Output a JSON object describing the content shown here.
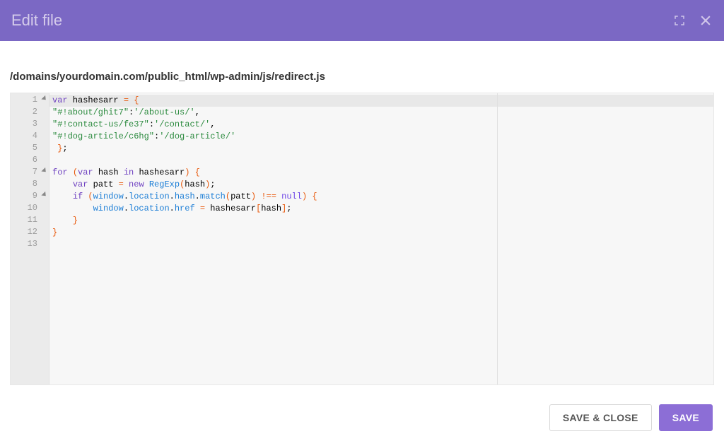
{
  "header": {
    "title": "Edit file"
  },
  "filepath": "/domains/yourdomain.com/public_html/wp-admin/js/redirect.js",
  "editor": {
    "line_count": 13,
    "fold_lines": [
      1,
      7,
      9
    ],
    "active_line": 1,
    "lines": [
      {
        "num": "1",
        "tokens": [
          {
            "t": "var",
            "c": "tok-kw"
          },
          {
            "t": " hashesarr ",
            "c": ""
          },
          {
            "t": "=",
            "c": "tok-op"
          },
          {
            "t": " ",
            "c": ""
          },
          {
            "t": "{",
            "c": "tok-punc"
          }
        ]
      },
      {
        "num": "2",
        "tokens": [
          {
            "t": "\"#!about/ghit7\"",
            "c": "tok-str"
          },
          {
            "t": ":",
            "c": ""
          },
          {
            "t": "'/about-us/'",
            "c": "tok-str"
          },
          {
            "t": ",",
            "c": ""
          }
        ]
      },
      {
        "num": "3",
        "tokens": [
          {
            "t": "\"#!contact-us/fe37\"",
            "c": "tok-str"
          },
          {
            "t": ":",
            "c": ""
          },
          {
            "t": "'/contact/'",
            "c": "tok-str"
          },
          {
            "t": ",",
            "c": ""
          }
        ]
      },
      {
        "num": "4",
        "tokens": [
          {
            "t": "\"#!dog-article/c6hg\"",
            "c": "tok-str"
          },
          {
            "t": ":",
            "c": ""
          },
          {
            "t": "'/dog-article/'",
            "c": "tok-str"
          }
        ]
      },
      {
        "num": "5",
        "tokens": [
          {
            "t": " ",
            "c": ""
          },
          {
            "t": "}",
            "c": "tok-punc"
          },
          {
            "t": ";",
            "c": ""
          }
        ]
      },
      {
        "num": "6",
        "tokens": []
      },
      {
        "num": "7",
        "tokens": [
          {
            "t": "for",
            "c": "tok-kw"
          },
          {
            "t": " ",
            "c": ""
          },
          {
            "t": "(",
            "c": "tok-punc"
          },
          {
            "t": "var",
            "c": "tok-kw"
          },
          {
            "t": " hash ",
            "c": ""
          },
          {
            "t": "in",
            "c": "tok-kw"
          },
          {
            "t": " hashesarr",
            "c": ""
          },
          {
            "t": ")",
            "c": "tok-punc"
          },
          {
            "t": " ",
            "c": ""
          },
          {
            "t": "{",
            "c": "tok-punc"
          }
        ]
      },
      {
        "num": "8",
        "tokens": [
          {
            "t": "    ",
            "c": ""
          },
          {
            "t": "var",
            "c": "tok-kw"
          },
          {
            "t": " patt ",
            "c": ""
          },
          {
            "t": "=",
            "c": "tok-op"
          },
          {
            "t": " ",
            "c": ""
          },
          {
            "t": "new",
            "c": "tok-kw"
          },
          {
            "t": " ",
            "c": ""
          },
          {
            "t": "RegExp",
            "c": "tok-ident"
          },
          {
            "t": "(",
            "c": "tok-punc"
          },
          {
            "t": "hash",
            "c": ""
          },
          {
            "t": ")",
            "c": "tok-punc"
          },
          {
            "t": ";",
            "c": ""
          }
        ]
      },
      {
        "num": "9",
        "tokens": [
          {
            "t": "    ",
            "c": ""
          },
          {
            "t": "if",
            "c": "tok-kw"
          },
          {
            "t": " ",
            "c": ""
          },
          {
            "t": "(",
            "c": "tok-punc"
          },
          {
            "t": "window",
            "c": "tok-ident"
          },
          {
            "t": ".",
            "c": ""
          },
          {
            "t": "location",
            "c": "tok-method"
          },
          {
            "t": ".",
            "c": ""
          },
          {
            "t": "hash",
            "c": "tok-method"
          },
          {
            "t": ".",
            "c": ""
          },
          {
            "t": "match",
            "c": "tok-method"
          },
          {
            "t": "(",
            "c": "tok-punc"
          },
          {
            "t": "patt",
            "c": ""
          },
          {
            "t": ")",
            "c": "tok-punc"
          },
          {
            "t": " ",
            "c": ""
          },
          {
            "t": "!==",
            "c": "tok-op"
          },
          {
            "t": " ",
            "c": ""
          },
          {
            "t": "null",
            "c": "tok-null"
          },
          {
            "t": ")",
            "c": "tok-punc"
          },
          {
            "t": " ",
            "c": ""
          },
          {
            "t": "{",
            "c": "tok-punc"
          }
        ]
      },
      {
        "num": "10",
        "tokens": [
          {
            "t": "        ",
            "c": ""
          },
          {
            "t": "window",
            "c": "tok-ident"
          },
          {
            "t": ".",
            "c": ""
          },
          {
            "t": "location",
            "c": "tok-method"
          },
          {
            "t": ".",
            "c": ""
          },
          {
            "t": "href",
            "c": "tok-method"
          },
          {
            "t": " ",
            "c": ""
          },
          {
            "t": "=",
            "c": "tok-op"
          },
          {
            "t": " hashesarr",
            "c": ""
          },
          {
            "t": "[",
            "c": "tok-punc"
          },
          {
            "t": "hash",
            "c": ""
          },
          {
            "t": "]",
            "c": "tok-punc"
          },
          {
            "t": ";",
            "c": ""
          }
        ]
      },
      {
        "num": "11",
        "tokens": [
          {
            "t": "    ",
            "c": ""
          },
          {
            "t": "}",
            "c": "tok-punc"
          }
        ]
      },
      {
        "num": "12",
        "tokens": [
          {
            "t": "}",
            "c": "tok-punc"
          }
        ]
      },
      {
        "num": "13",
        "tokens": []
      }
    ]
  },
  "footer": {
    "save_close_label": "SAVE & CLOSE",
    "save_label": "SAVE"
  }
}
